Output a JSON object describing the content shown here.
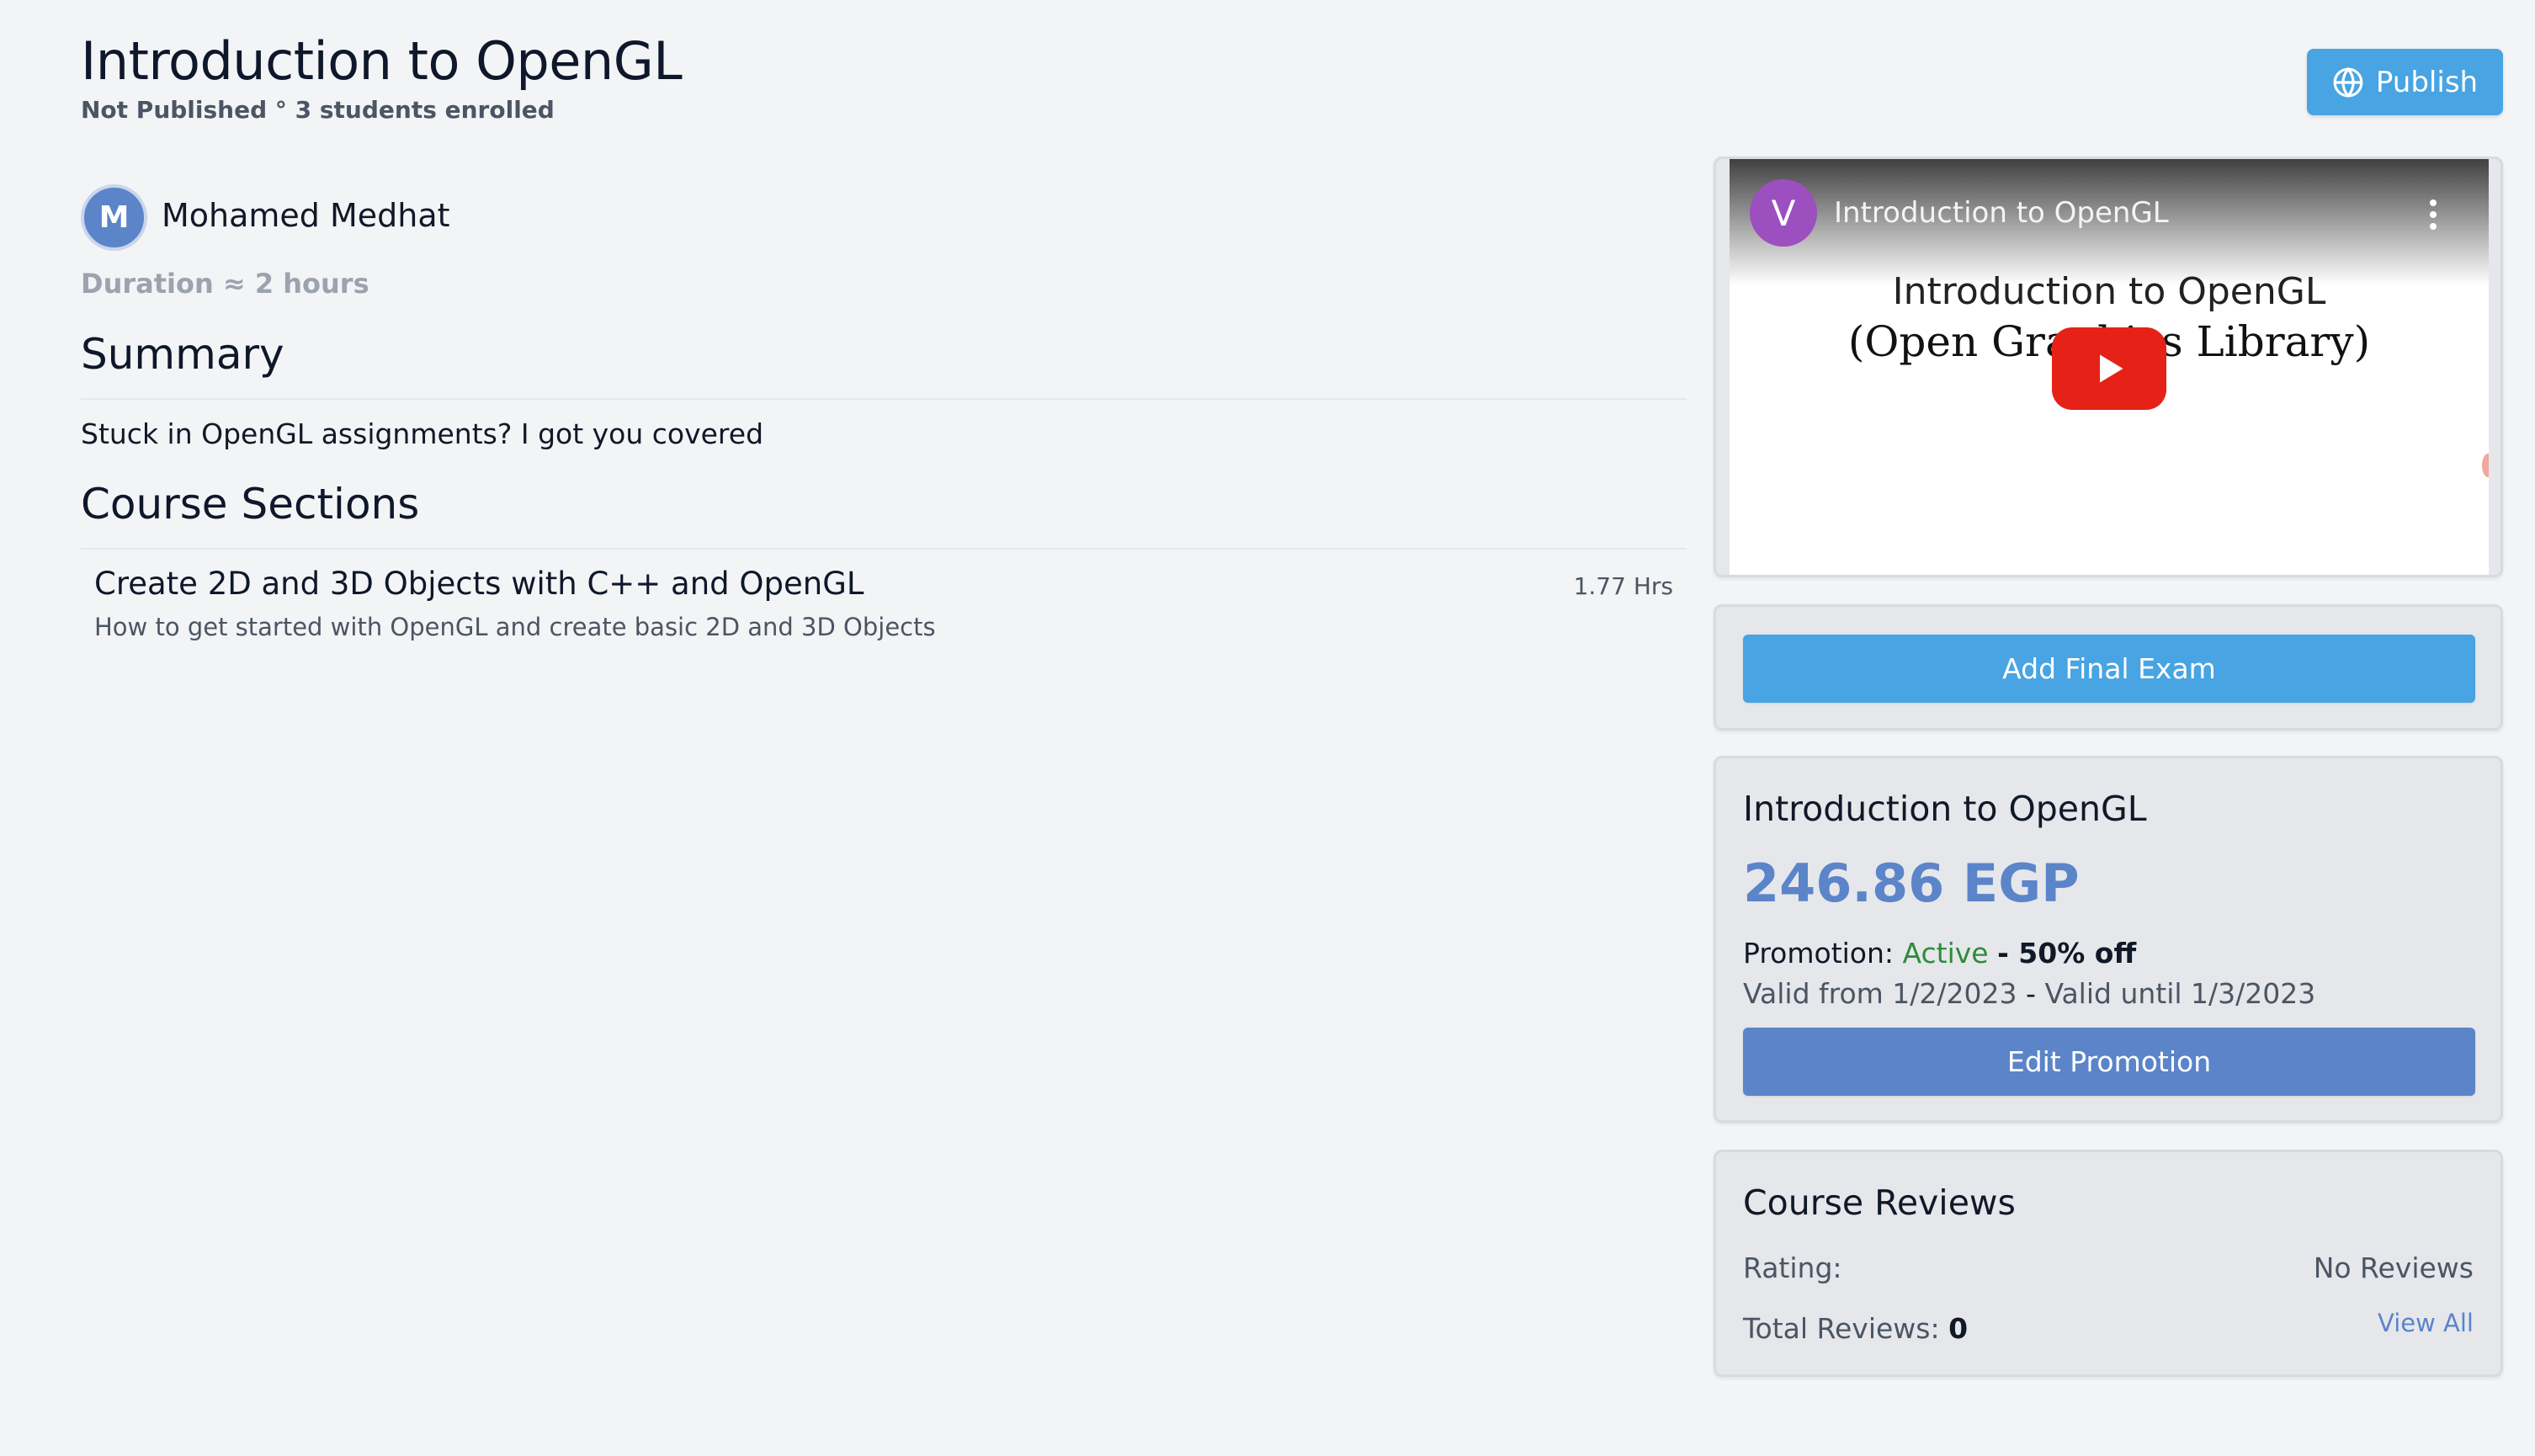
{
  "header": {
    "title": "Introduction to OpenGL",
    "status": "Not Published",
    "separator": "°",
    "enrollment": "3 students enrolled",
    "publish_label": "Publish"
  },
  "instructor": {
    "initial": "M",
    "name": "Mohamed Medhat",
    "duration_label": "Duration",
    "duration_value": "≈ 2 hours"
  },
  "summary": {
    "heading": "Summary",
    "text": "Stuck in OpenGL assignments? I got you covered"
  },
  "sections": {
    "heading": "Course Sections",
    "items": [
      {
        "title": "Create 2D and 3D Objects with C++ and OpenGL",
        "description": "How to get started with OpenGL and create basic 2D and 3D Objects",
        "duration": "1.77 Hrs"
      }
    ]
  },
  "video": {
    "channel_initial": "V",
    "title": "Introduction to OpenGL",
    "slide_line1": "Introduction to OpenGL",
    "slide_line2": "(Open Graphics Library)"
  },
  "exam": {
    "button_label": "Add Final Exam"
  },
  "pricing": {
    "course_title": "Introduction to OpenGL",
    "price": "246.86 EGP",
    "promotion_label": "Promotion:",
    "promotion_status": "Active",
    "promotion_discount": "- 50% off",
    "valid_from": "Valid from 1/2/2023",
    "valid_separator": "-",
    "valid_until": "Valid until 1/3/2023",
    "edit_button_label": "Edit Promotion"
  },
  "reviews": {
    "heading": "Course Reviews",
    "rating_label": "Rating:",
    "rating_value": "No Reviews",
    "total_label": "Total Reviews:",
    "total_value": "0",
    "view_all_label": "View All"
  },
  "colors": {
    "background": "#f3f4f6",
    "publish_button": "#48a4e2",
    "accent_blue": "#5b84c9",
    "active_green": "#2e8b3a",
    "youtube_red": "#e62117"
  },
  "icons": {
    "publish": "globe-icon",
    "play": "play-icon",
    "video_menu": "more-vertical-icon"
  }
}
